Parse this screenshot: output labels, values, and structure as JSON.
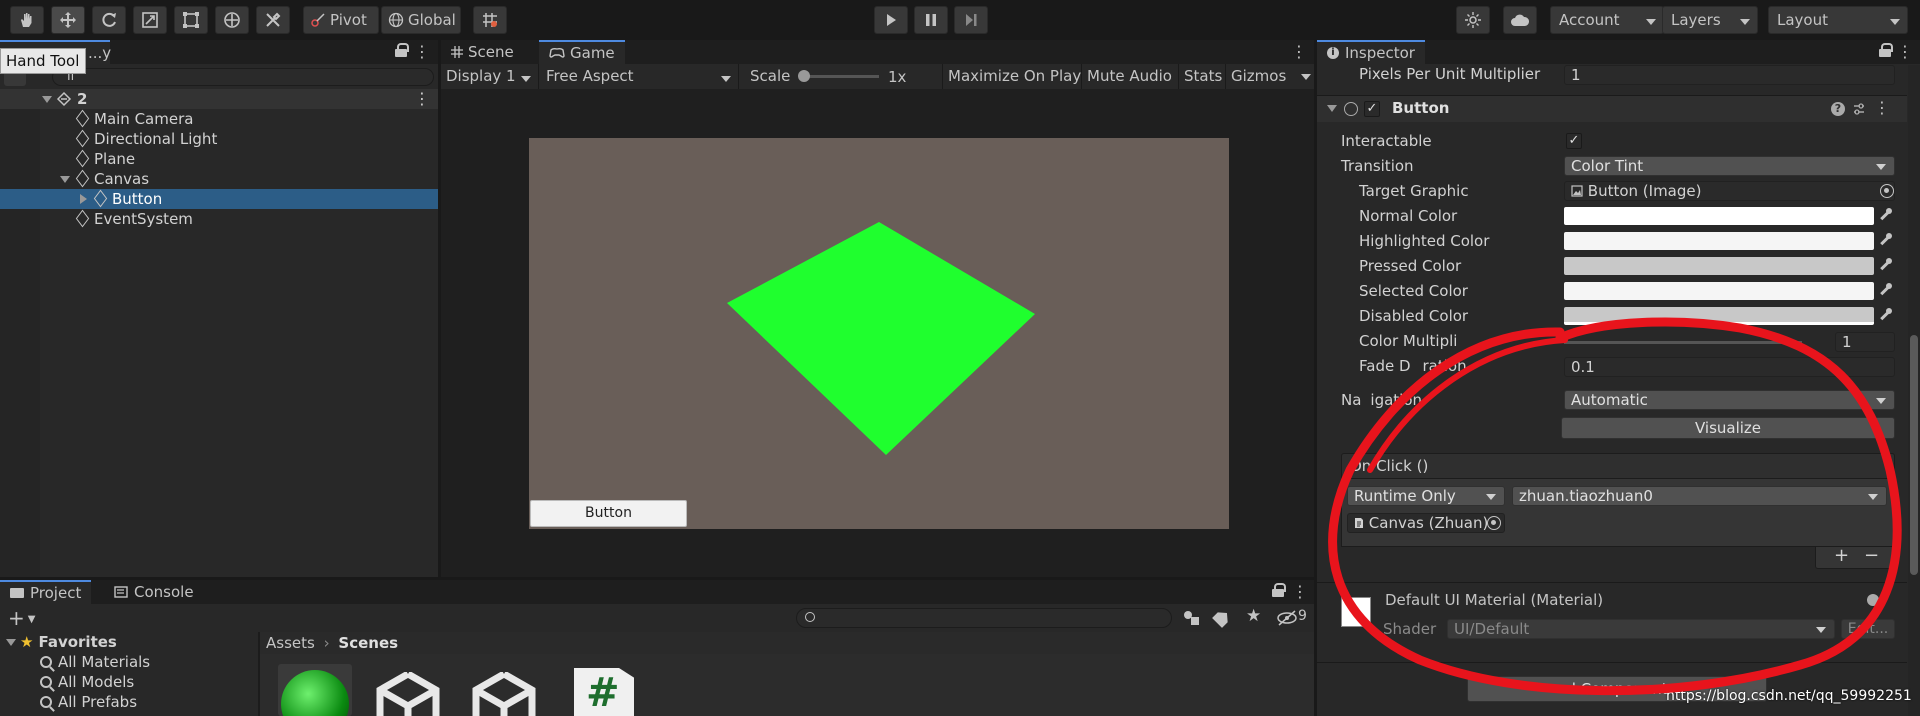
{
  "toolbar": {
    "pivot_label": "Pivot",
    "global_label": "Global",
    "account_label": "Account",
    "layers_label": "Layers",
    "layout_label": "Layout",
    "tools": [
      "hand-tool-icon",
      "move-tool-icon",
      "rotate-tool-icon",
      "scale-tool-icon",
      "rect-tool-icon",
      "transform-tool-icon",
      "custom-tool-icon"
    ],
    "tooltip": "Hand Tool"
  },
  "hierarchy": {
    "tab_label": "Hierarchy",
    "tab_visible": "...y",
    "search_value": "All",
    "search_visible": "ll",
    "scene_name": "2",
    "items": [
      {
        "label": "Main Camera"
      },
      {
        "label": "Directional Light"
      },
      {
        "label": "Plane"
      },
      {
        "label": "Canvas"
      },
      {
        "label": "Button"
      },
      {
        "label": "EventSystem"
      }
    ]
  },
  "game": {
    "scene_tab": "Scene",
    "game_tab": "Game",
    "display": "Display 1",
    "aspect": "Free Aspect",
    "scale_label": "Scale",
    "scale_value": "1x",
    "maximize": "Maximize On Play",
    "mute": "Mute Audio",
    "stats": "Stats",
    "gizmos": "Gizmos",
    "button_label": "Button",
    "colors": {
      "background": "#695e58",
      "plane": "#1fff2e"
    }
  },
  "inspector": {
    "tab_label": "Inspector",
    "ppu_label": "Pixels Per Unit Multiplier",
    "ppu_value": "1",
    "component_name": "Button",
    "interactable_label": "Interactable",
    "transition_label": "Transition",
    "transition_value": "Color Tint",
    "target_graphic_label": "Target Graphic",
    "target_graphic_value": "Button (Image)",
    "normal_color_label": "Normal Color",
    "highlighted_color_label": "Highlighted Color",
    "pressed_color_label": "Pressed Color",
    "selected_color_label": "Selected Color",
    "disabled_color_label": "Disabled Color",
    "color_multiplier_label": "Color Multiplier",
    "color_multiplier_visible": "Color Multipli",
    "color_multiplier_value": "1",
    "fade_duration_label": "Fade Duration",
    "fade_duration_visible_a": "Fade D",
    "fade_duration_visible_b": "ration",
    "fade_duration_value": "0.1",
    "navigation_label": "Navigation",
    "navigation_visible_a": "Na",
    "navigation_visible_b": "igation",
    "navigation_value": "Automatic",
    "visualize_label": "Visualize",
    "onclick_label": "On Click ()",
    "runtime_value": "Runtime Only",
    "function_value": "zhuan.tiaozhuan0",
    "object_value": "Canvas (Zhuan)",
    "add_label": "+",
    "remove_label": "−",
    "material_name": "Default UI Material (Material)",
    "shader_label": "Shader",
    "shader_value": "UI/Default",
    "edit_label": "Edit...",
    "add_component_visible": "d Component",
    "swatch_colors": {
      "normal": "#ffffff",
      "highlighted": "#f5f5f5",
      "pressed": "#c8c8c8",
      "selected": "#f5f5f5",
      "disabled": "#c8c8c8"
    }
  },
  "project": {
    "project_tab": "Project",
    "console_tab": "Console",
    "favorites_label": "Favorites",
    "favorites": [
      {
        "label": "All Materials"
      },
      {
        "label": "All Models"
      },
      {
        "label": "All Prefabs"
      }
    ],
    "breadcrumb_root": "Assets",
    "breadcrumb_current": "Scenes",
    "hidden_count": "9"
  },
  "watermark": "https://blog.csdn.net/qq_59992251"
}
